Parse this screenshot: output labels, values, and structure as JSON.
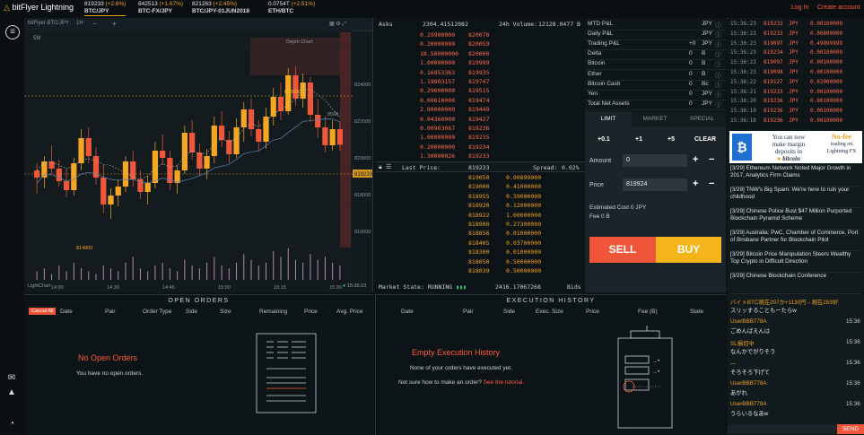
{
  "app": {
    "logo": "bitFlyer Lightning",
    "login": "Log In",
    "create": "Create account"
  },
  "tickers": [
    {
      "price": "819233",
      "change": "(+2.6%)",
      "name": "BTC/JPY"
    },
    {
      "price": "842513",
      "change": "(+1.67%)",
      "name": "BTC-FX/JPY"
    },
    {
      "price": "821263",
      "change": "(+2.45%)",
      "name": "BTC/JPY-01JUN2018"
    },
    {
      "price": "0.0754T",
      "change": "(+2.51%)",
      "name": "ETH/BTC"
    }
  ],
  "chart": {
    "pair": "bitFlyer BTC/JPY",
    "interval": "1H",
    "label_top": "5M",
    "overlay_label": "Depth Chart",
    "last_price_tag": "819233",
    "high_tag": "823500",
    "low_tag": "814800",
    "mid_tag": "8560",
    "y_ticks": [
      "824000",
      "822000",
      "820000",
      "818000",
      "816000"
    ],
    "x_ticks": [
      "14:00",
      "14:30",
      "14:45",
      "15:00",
      "15:15",
      "15:30"
    ],
    "footer_left": "LightChart",
    "footer_time": "15:36:23",
    "footer_right": "MA"
  },
  "chart_data": {
    "type": "candlestick",
    "ylim": [
      813500,
      825500
    ],
    "candles": [
      [
        817800,
        818200,
        816500,
        817400
      ],
      [
        817400,
        818600,
        816800,
        818300
      ],
      [
        818300,
        819200,
        817600,
        817900
      ],
      [
        817900,
        818400,
        816900,
        817200
      ],
      [
        817200,
        817900,
        816300,
        816700
      ],
      [
        816700,
        818500,
        816400,
        818200
      ],
      [
        818200,
        820100,
        817800,
        819600
      ],
      [
        819600,
        820200,
        818200,
        818600
      ],
      [
        818600,
        819100,
        817000,
        817400
      ],
      [
        817400,
        818100,
        815400,
        815900
      ],
      [
        815900,
        816800,
        815100,
        816400
      ],
      [
        816400,
        817300,
        815800,
        816900
      ],
      [
        816900,
        818600,
        816600,
        818300
      ],
      [
        818300,
        818900,
        816900,
        817300
      ],
      [
        817300,
        817800,
        816200,
        816600
      ],
      [
        816600,
        817500,
        815900,
        817100
      ],
      [
        817100,
        819400,
        816800,
        818900
      ],
      [
        818900,
        819800,
        818100,
        818500
      ],
      [
        818500,
        818900,
        816700,
        817100
      ],
      [
        817100,
        818100,
        816500,
        817800
      ],
      [
        817800,
        820300,
        817600,
        819900
      ],
      [
        819900,
        820600,
        818400,
        818800
      ],
      [
        818800,
        819300,
        817500,
        817900
      ],
      [
        817900,
        819000,
        817300,
        818600
      ],
      [
        818600,
        820800,
        818200,
        820300
      ],
      [
        820300,
        821100,
        819100,
        819500
      ],
      [
        819500,
        820000,
        818200,
        818700
      ],
      [
        818700,
        820700,
        818500,
        820200
      ],
      [
        820200,
        821600,
        819400,
        821200
      ],
      [
        821200,
        821800,
        819700,
        820100
      ],
      [
        820100,
        820600,
        818900,
        819400
      ],
      [
        819400,
        821300,
        819000,
        820800
      ],
      [
        820800,
        822400,
        820300,
        821900
      ],
      [
        821900,
        822700,
        820600,
        821100
      ],
      [
        821100,
        823500,
        820900,
        823100
      ],
      [
        823100,
        823600,
        821400,
        821800
      ],
      [
        821800,
        823200,
        821300,
        822700
      ],
      [
        822700,
        823000,
        820500,
        820900
      ],
      [
        820900,
        821800,
        819600,
        820200
      ],
      [
        820200,
        820800,
        818800,
        819200
      ],
      [
        819200,
        820600,
        818900,
        820100
      ],
      [
        820100,
        820500,
        818900,
        819233
      ]
    ],
    "volume": [
      3,
      4,
      2,
      5,
      3,
      6,
      4,
      3,
      2,
      5,
      4,
      3,
      6,
      8,
      4,
      3,
      5,
      6,
      4,
      3,
      7,
      5,
      4,
      6,
      8,
      5,
      4,
      6,
      9,
      7,
      5,
      6,
      10,
      8,
      11,
      7,
      6,
      9,
      7,
      8,
      6,
      5
    ]
  },
  "book": {
    "asks_label": "Asks",
    "asks_total": "2304.41512082",
    "vol_label": "24h Volume:",
    "vol_value": "12128.0477 B",
    "asks": [
      [
        "0.29900000",
        "820070"
      ],
      [
        "0.20000000",
        "820059"
      ],
      [
        "18.50000000",
        "820000"
      ],
      [
        "1.00000000",
        "819999"
      ],
      [
        "0.16953363",
        "819935"
      ],
      [
        "1.19803157",
        "819747"
      ],
      [
        "0.29000000",
        "819515"
      ],
      [
        "0.00610000",
        "819474"
      ],
      [
        "2.00000000",
        "819449"
      ],
      [
        "0.04360000",
        "819427"
      ],
      [
        "0.00903067",
        "819236"
      ],
      [
        "1.00000000",
        "819235"
      ],
      [
        "0.20000000",
        "819234"
      ],
      [
        "1.30000026",
        "819233"
      ]
    ],
    "last_label": "Last Price:",
    "last_value": "819233",
    "spread_label": "Spread:",
    "spread_value": "0.02%",
    "bids": [
      [
        "819050",
        "0.00899000"
      ],
      [
        "819000",
        "0.41000000"
      ],
      [
        "818955",
        "0.39000000"
      ],
      [
        "818920",
        "0.12000000"
      ],
      [
        "818922",
        "1.00000000"
      ],
      [
        "818900",
        "0.27300000"
      ],
      [
        "818856",
        "0.01000000"
      ],
      [
        "818405",
        "0.03700000"
      ],
      [
        "818300",
        "0.01000000"
      ],
      [
        "818050",
        "0.50000000"
      ],
      [
        "818039",
        "0.50000000"
      ]
    ],
    "market_state": "Market State: RUNNING",
    "bids_total": "2416.17067268",
    "bids_label": "Bids"
  },
  "pnl": {
    "rows": [
      {
        "label": "MTD P&L",
        "unit": "JPY",
        "value": ""
      },
      {
        "label": "Daily P&L",
        "unit": "JPY",
        "value": ""
      },
      {
        "label": "Trading P&L",
        "unit": "JPY",
        "value": "+0"
      },
      {
        "label": "Delta",
        "unit": "B",
        "value": "0"
      },
      {
        "label": "Bitcoin",
        "unit": "B",
        "value": "0"
      },
      {
        "label": "Ether",
        "unit": "B",
        "value": "0"
      },
      {
        "label": "Bitcoin Cash",
        "unit": "Bc",
        "value": "0"
      },
      {
        "label": "Yen",
        "unit": "JPY",
        "value": "0"
      },
      {
        "label": "Total Net Assets",
        "unit": "JPY",
        "value": "0"
      }
    ]
  },
  "trades": [
    [
      "15:36:23",
      "819233",
      "JPY",
      "0.00100000"
    ],
    [
      "15:36:23",
      "819233",
      "JPY",
      "0.00800000"
    ],
    [
      "15:36:23",
      "819097",
      "JPY",
      "0.49899999"
    ],
    [
      "15:36:23",
      "819234",
      "JPY",
      "0.00100000"
    ],
    [
      "15:36:23",
      "819097",
      "JPY",
      "0.00100000"
    ],
    [
      "15:36:23",
      "819098",
      "JPY",
      "0.00100000"
    ],
    [
      "15:36:22",
      "819127",
      "JPY",
      "0.02000000"
    ],
    [
      "15:36:21",
      "819233",
      "JPY",
      "0.00100000"
    ],
    [
      "15:36:20",
      "819236",
      "JPY",
      "0.00100000"
    ],
    [
      "15:36:19",
      "819236",
      "JPY",
      "0.00100000"
    ],
    [
      "15:36:18",
      "819236",
      "JPY",
      "0.00100000"
    ]
  ],
  "order": {
    "tabs": [
      "LIMIT",
      "MARKET",
      "SPECIAL"
    ],
    "increments": [
      "+0.1",
      "+1",
      "+5",
      "CLEAR"
    ],
    "amount_label": "Amount",
    "amount_value": "0",
    "price_label": "Price",
    "price_value": "819924",
    "est_cost": "Estimated Cost 0 JPY",
    "fee": "Fee 0 B",
    "sell": "SELL",
    "buy": "BUY"
  },
  "ad": {
    "line1": "You can now",
    "line2": "make margin",
    "line3": "deposits in",
    "brand": "bitcoin",
    "nofee": "No-fee",
    "trading": "trading on",
    "lightning": "Lightning FX"
  },
  "news": [
    "[3/29] Ethereum Network Noted Major Growth in 2017, Analytics Firm Claims",
    "[3/29] TNW's Big Spam: We're here to ruin your childhood",
    "[3/29] Chinese Police Bust $47 Million Purported Blockchain Pyramid Scheme",
    "[3/29] Australia: PwC, Chamber of Commerce, Port of Brisbane Partner for Blockchain Pilot",
    "[3/29] Bitcoin Price Manipulation Steers Wealthy Top Crypto in Difficult Direction",
    "[3/29] Chinese Blockchain Conference"
  ],
  "open_orders": {
    "title": "OPEN ORDERS",
    "cancel_all": "Cancel All",
    "cols": [
      "Date",
      "Pair",
      "Order Type",
      "Side",
      "Size",
      "Remaining",
      "Price",
      "Avg. Price"
    ],
    "empty_title": "No Open Orders",
    "empty_sub": "You have no open orders."
  },
  "exec": {
    "title": "EXECUTION HISTORY",
    "cols": [
      "Date",
      "Pair",
      "Side",
      "Exec. Size",
      "Price",
      "Fee (B)",
      "State"
    ],
    "empty_title": "Empty Execution History",
    "empty_sub": "None of your orders have executed yet.",
    "tutorial_pre": "Not sure how to make an order?",
    "tutorial_link": "See the tutorial."
  },
  "chat": {
    "messages": [
      {
        "user": "バイトBTC現在207か+1130円→現在2839円)",
        "time": "",
        "text": "スリッすることもーたらw"
      },
      {
        "user": "UserBBB778A",
        "time": "15:36",
        "text": "ごめんばえんは"
      },
      {
        "user": "SL損切中",
        "time": "15:36",
        "text": "なんかでがりそう"
      },
      {
        "user": "ー",
        "time": "15:36",
        "text": "そろそろ下げて"
      },
      {
        "user": "UserBBB778A",
        "time": "15:36",
        "text": "あがれ"
      },
      {
        "user": "UserBBB778A",
        "time": "15:36",
        "text": "うらいるなあw"
      }
    ],
    "send": "SEND"
  }
}
